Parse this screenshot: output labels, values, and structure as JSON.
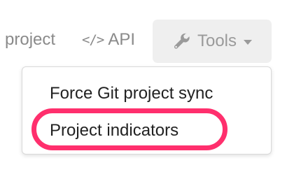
{
  "nav": {
    "project_label": "project",
    "api_label": "API",
    "api_icon_name": "code-icon",
    "api_icon_text": "</>"
  },
  "tools": {
    "label": "Tools",
    "icon": "wrench-icon",
    "caret_icon": "chevron-down-icon"
  },
  "dropdown": {
    "items": [
      {
        "label": "Force Git project sync"
      },
      {
        "label": "Project indicators"
      }
    ]
  },
  "annotation": {
    "highlight_color": "#ff2f6d"
  },
  "colors": {
    "nav_text": "#8a8a8a",
    "tools_bg": "#efefef",
    "menu_text": "#222222"
  }
}
